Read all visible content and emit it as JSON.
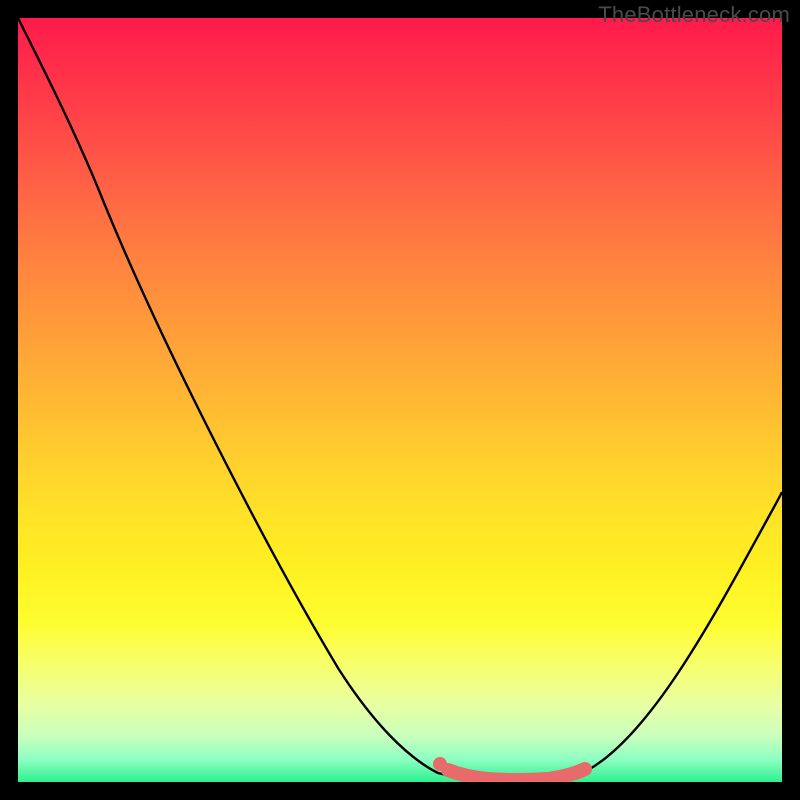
{
  "watermark": {
    "text": "TheBottleneck.com"
  },
  "colors": {
    "line": "#000000",
    "marker_fill": "#e86a6a",
    "marker_stroke": "#d85858"
  },
  "chart_data": {
    "type": "line",
    "title": "",
    "xlabel": "",
    "ylabel": "",
    "xlim": [
      0,
      100
    ],
    "ylim": [
      0,
      100
    ],
    "grid": false,
    "legend": false,
    "annotations": [
      "TheBottleneck.com"
    ],
    "series": [
      {
        "name": "bottleneck-curve",
        "x": [
          0,
          4,
          8,
          12,
          16,
          20,
          24,
          28,
          32,
          36,
          40,
          44,
          48,
          52,
          55,
          58,
          61,
          64,
          67,
          70,
          73,
          76,
          80,
          84,
          88,
          92,
          96,
          100
        ],
        "y": [
          100,
          98,
          95,
          91,
          86,
          80,
          74,
          67,
          60,
          52,
          44,
          36,
          28,
          20,
          13,
          7,
          3,
          1,
          0,
          0,
          0,
          1,
          4,
          9,
          16,
          24,
          33,
          43
        ]
      },
      {
        "name": "optimal-range-marker",
        "x": [
          55,
          58,
          61,
          64,
          67,
          70,
          73
        ],
        "y": [
          2,
          1,
          0,
          0,
          0,
          0,
          1
        ]
      }
    ]
  }
}
